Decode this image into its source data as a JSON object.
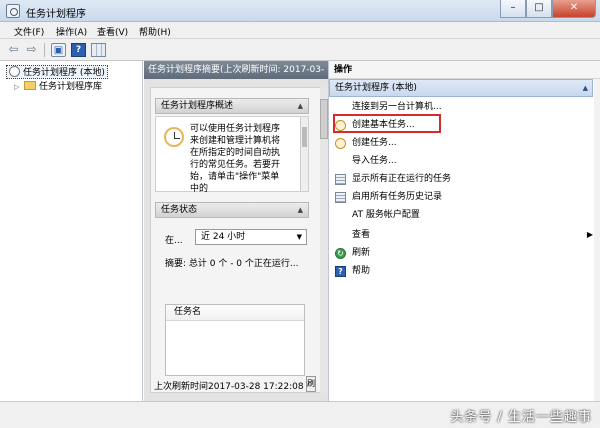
{
  "window": {
    "title": "任务计划程序",
    "minimize": "–",
    "maximize": "□",
    "close": "✕"
  },
  "menu": [
    {
      "label": "文件(F)"
    },
    {
      "label": "操作(A)"
    },
    {
      "label": "查看(V)"
    },
    {
      "label": "帮助(H)"
    }
  ],
  "toolbar": {
    "icons": [
      "back-arrow-icon",
      "forward-arrow-icon",
      "console-tree-icon",
      "help-icon",
      "grid-icon"
    ],
    "help_glyph": "?"
  },
  "tree": {
    "root": "任务计划程序 (本地)",
    "child": "任务计划程序库",
    "expander": "▷"
  },
  "middle": {
    "header": "任务计划程序摘要(上次刷新时间: 2017-03-",
    "overview_title": "任务计划程序概述",
    "overview_text": "可以使用任务计划程序来创建和管理计算机将在所指定的时间自动执行的常见任务。若要开始，请单击\"操作\"菜单中的",
    "status_title": "任务状态",
    "filter_label": "在...",
    "filter_value": "近 24 小时",
    "summary": "摘要: 总计 0 个 - 0 个正在运行...",
    "table_header": "任务名",
    "last_refresh": "上次刷新时间2017-03-28 17:22:08",
    "refresh_btn": "刷",
    "collapse_glyph": "▲",
    "dropdown_glyph": "▼"
  },
  "actions": {
    "title": "操作",
    "section": "任务计划程序 (本地)",
    "items": [
      {
        "label": "连接到另一台计算机...",
        "icon": "none"
      },
      {
        "label": "创建基本任务...",
        "icon": "clock-icon"
      },
      {
        "label": "创建任务...",
        "icon": "clock-icon"
      },
      {
        "label": "导入任务...",
        "icon": "none"
      },
      {
        "label": "显示所有正在运行的任务",
        "icon": "list-icon"
      },
      {
        "label": "启用所有任务历史记录",
        "icon": "list-icon"
      },
      {
        "label": "AT 服务帐户配置",
        "icon": "none"
      },
      {
        "label": "查看",
        "icon": "none"
      },
      {
        "label": "刷新",
        "icon": "refresh-icon"
      },
      {
        "label": "帮助",
        "icon": "help-icon"
      }
    ],
    "submenu_glyph": "▶",
    "highlight_color": "#d52b2b"
  },
  "watermark": "头条号 / 生活一些趣事"
}
